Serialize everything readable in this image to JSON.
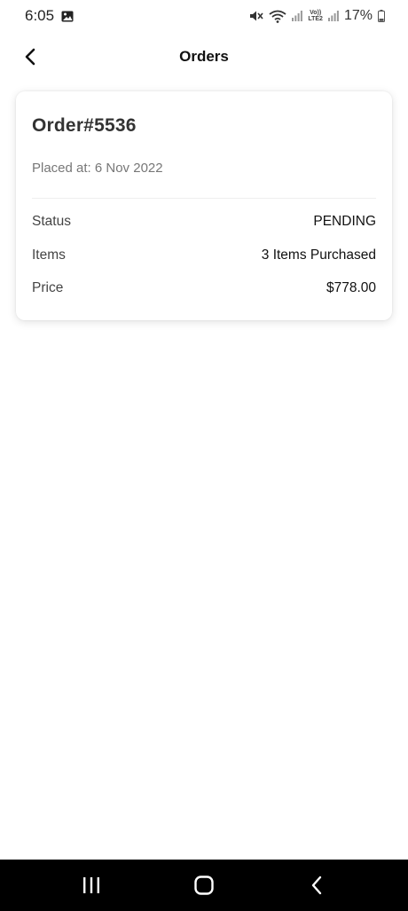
{
  "status_bar": {
    "time": "6:05",
    "battery": "17%",
    "icons": [
      "gallery-icon",
      "mute-icon",
      "wifi-icon",
      "signal-icon",
      "volte-lte2-icon",
      "signal-icon",
      "battery-icon"
    ],
    "lte_line1": "Vo))",
    "lte_line2": "LTE2"
  },
  "header": {
    "title": "Orders",
    "back_icon": "chevron-left-icon"
  },
  "order": {
    "number": "Order#5536",
    "placed_at": "Placed at: 6 Nov 2022",
    "rows": [
      {
        "label": "Status",
        "value": "PENDING"
      },
      {
        "label": "Items",
        "value": "3 Items Purchased"
      },
      {
        "label": "Price",
        "value": "$778.00"
      }
    ]
  },
  "nav_bar": {
    "icons": [
      "recents-icon",
      "home-icon",
      "back-icon"
    ]
  },
  "colors": {
    "background": "#ffffff",
    "nav_bar": "#000000",
    "text_primary": "#111111",
    "text_secondary": "#777777"
  }
}
